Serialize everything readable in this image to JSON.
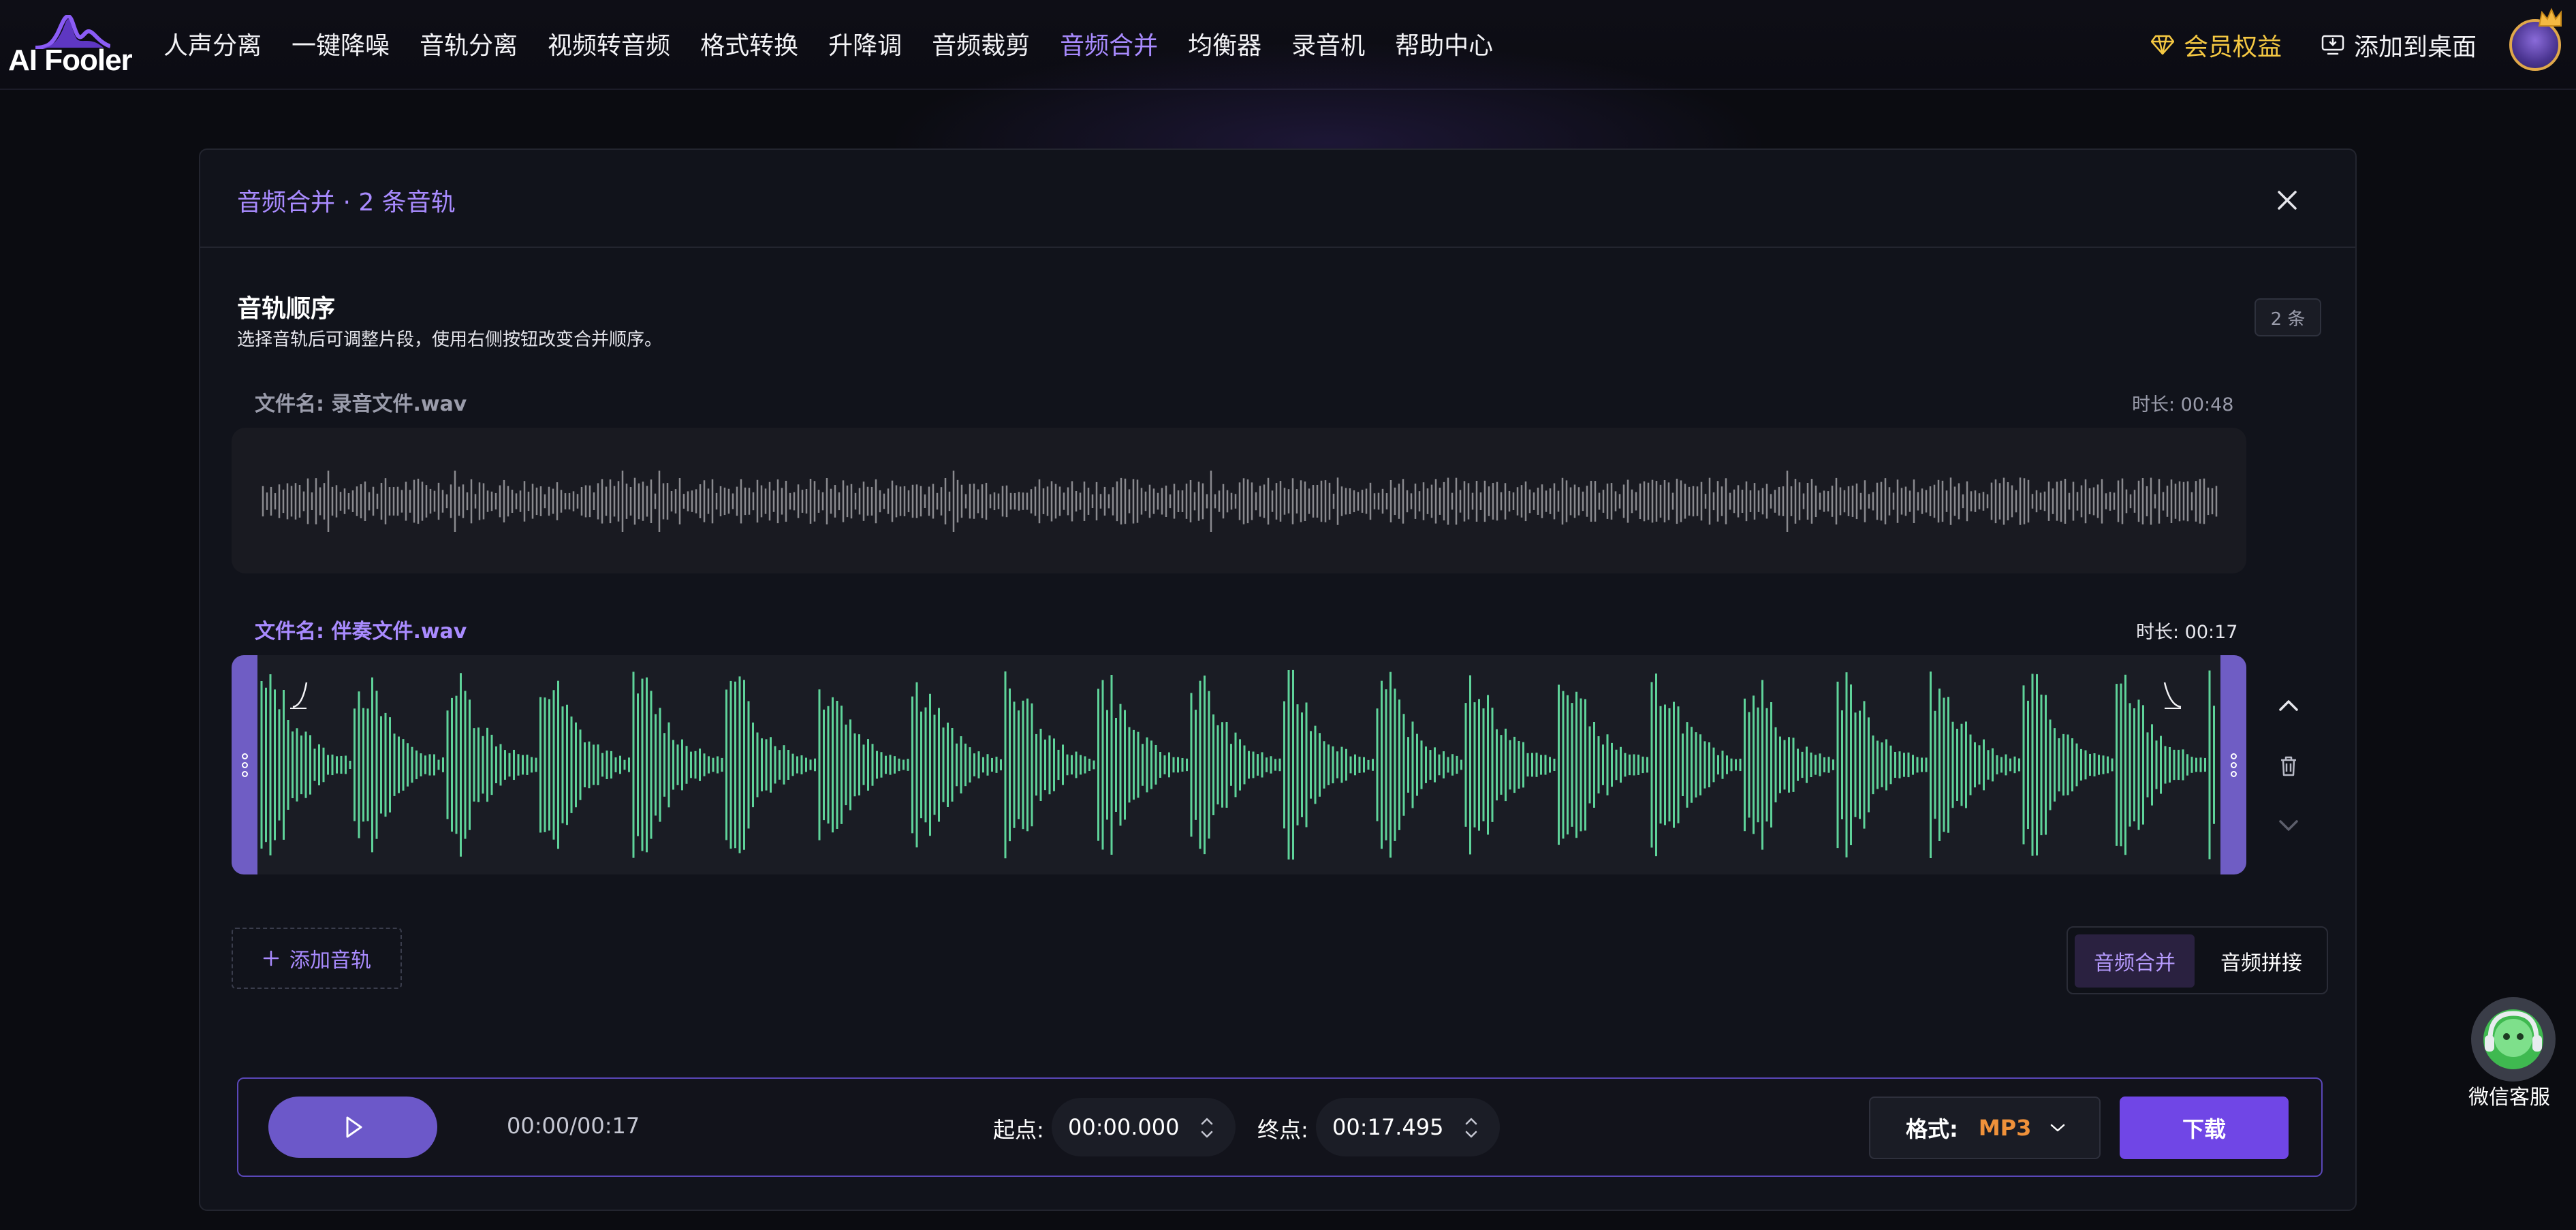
{
  "brand": {
    "name": "AI Fooler"
  },
  "nav": {
    "items": [
      {
        "label": "人声分离"
      },
      {
        "label": "一键降噪"
      },
      {
        "label": "音轨分离"
      },
      {
        "label": "视频转音频"
      },
      {
        "label": "格式转换"
      },
      {
        "label": "升降调"
      },
      {
        "label": "音频裁剪"
      },
      {
        "label": "音频合并",
        "active": true
      },
      {
        "label": "均衡器"
      },
      {
        "label": "录音机"
      },
      {
        "label": "帮助中心"
      }
    ],
    "vip_label": "会员权益",
    "desktop_label": "添加到桌面"
  },
  "dialog": {
    "title": "音频合并 · 2 条音轨",
    "section_title": "音轨顺序",
    "section_hint": "选择音轨后可调整片段，使用右侧按钮改变合并顺序。",
    "count_badge": "2 条"
  },
  "tracks": [
    {
      "label": "文件名: 录音文件.wav",
      "duration": "时长: 00:48",
      "selected": false,
      "wave_color": "#8a8a8f"
    },
    {
      "label": "文件名: 伴奏文件.wav",
      "duration": "时长: 00:17",
      "selected": true,
      "wave_color": "#5fd39a"
    }
  ],
  "add_track_label": "添加音轨",
  "mode": {
    "merge_label": "音频合并",
    "concat_label": "音频拼接",
    "active": "merge"
  },
  "player": {
    "time": "00:00/00:17",
    "start_label": "起点:",
    "start_value": "00:00.000",
    "end_label": "终点:",
    "end_value": "00:17.495",
    "format_label": "格式:",
    "format_value": "MP3",
    "download_label": "下载"
  },
  "service": {
    "label": "微信客服"
  },
  "colors": {
    "accent": "#a98bff",
    "gold": "#f5c842",
    "download": "#7046e6",
    "wave_selected": "#5fd39a"
  }
}
